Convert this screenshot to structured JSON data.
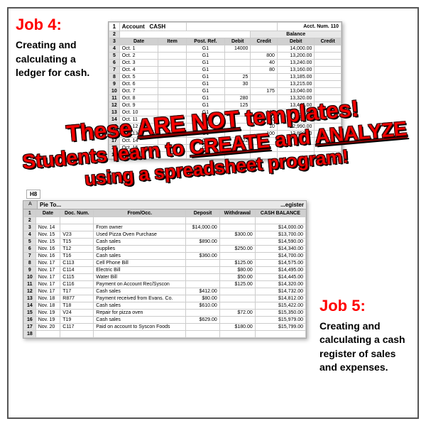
{
  "job4": {
    "title": "Job 4:",
    "description": "Creating and calculating a ledger for cash."
  },
  "job5": {
    "title": "Job 5:",
    "description": "Creating and calculating a cash register of sales and expenses."
  },
  "overlay": {
    "line1": "These ARE NOT templates!",
    "line2": "Students learn to CREATE and ANALYZE",
    "line3": "using a spreadsheet program!"
  },
  "spreadsheet1": {
    "title": "Account  CASH",
    "acct_num": "Acct. Num. 110",
    "col_headers": [
      "Date",
      "Item",
      "Post. Ref.",
      "Debit",
      "Credit",
      "Debit",
      "Credit"
    ],
    "rows": [
      [
        "4",
        "Oct. 1",
        "",
        "G1",
        "14000",
        "",
        "14,000.00",
        ""
      ],
      [
        "5",
        "Oct. 2",
        "",
        "G1",
        "",
        "800",
        "13,200.00",
        ""
      ],
      [
        "6",
        "Oct. 3",
        "",
        "G1",
        "",
        "40",
        "13,240.00",
        ""
      ],
      [
        "7",
        "Oct. 4",
        "",
        "G1",
        "",
        "80",
        "13,160.00",
        ""
      ],
      [
        "8",
        "Oct. 5",
        "",
        "G1",
        "25",
        "",
        "13,185.00",
        ""
      ],
      [
        "9",
        "Oct. 6",
        "",
        "G1",
        "30",
        "",
        "13,215.00",
        ""
      ],
      [
        "10",
        "Oct. 7",
        "",
        "G1",
        "",
        "175",
        "13,040.00",
        ""
      ],
      [
        "11",
        "Oct. 8",
        "",
        "G1",
        "280",
        "",
        "13,320.00",
        ""
      ],
      [
        "12",
        "Oct. 9",
        "",
        "G1",
        "125",
        "",
        "13,445.00",
        ""
      ],
      [
        "13",
        "Oct. 10",
        "",
        "G1",
        "",
        "125",
        "13,320.00",
        ""
      ],
      [
        "14",
        "Oct. 11",
        "",
        "G1",
        "",
        "220",
        "13,100.00",
        ""
      ],
      [
        "15",
        "Oct. 12",
        "",
        "G1",
        "",
        "10",
        "12,990.00",
        ""
      ],
      [
        "16",
        "Oct. 13",
        "",
        "G1",
        "",
        "100",
        "12,890.00",
        ""
      ],
      [
        "17",
        "Oct. 14",
        "",
        "G1",
        "422",
        "",
        "",
        ""
      ],
      [
        "18",
        "Oct. 15",
        "",
        "G1",
        "",
        "",
        "",
        ""
      ],
      [
        "19",
        "",
        "",
        "",
        "",
        "",
        "",
        ""
      ]
    ]
  },
  "spreadsheet2": {
    "title": "Pie To...",
    "subtitle": "...egister",
    "cell_ref": "H8",
    "col_headers": [
      "Date",
      "Doc. Num.",
      "From/Occ.",
      "Deposit",
      "Withdrawal",
      "CASH BALANCE"
    ],
    "rows": [
      [
        "2",
        "",
        "",
        "",
        "",
        ""
      ],
      [
        "3",
        "Nov. 14",
        "",
        "From owner",
        "$14,000.00",
        "",
        "$14,000.00"
      ],
      [
        "4",
        "Nov. 15",
        "V23",
        "Used Pizza Oven Purchase",
        "",
        "$300.00",
        "$13,700.00"
      ],
      [
        "5",
        "Nov. 15",
        "T15",
        "Cash sales",
        "$890.00",
        "",
        "$14,590.00"
      ],
      [
        "6",
        "Nov. 16",
        "T12",
        "Supplies",
        "",
        "$250.00",
        "$14,340.00"
      ],
      [
        "7",
        "Nov. 16",
        "T16",
        "Cash sales",
        "$360.00",
        "",
        "$14,700.00"
      ],
      [
        "8",
        "Nov. 17",
        "C113",
        "Cell Phone Bill",
        "",
        "$125.00",
        "$14,575.00"
      ],
      [
        "9",
        "Nov. 17",
        "C114",
        "Electric Bill",
        "",
        "$80.00",
        "$14,495.00"
      ],
      [
        "10",
        "Nov. 17",
        "C115",
        "Water Bill",
        "",
        "$50.00",
        "$14,445.00"
      ],
      [
        "11",
        "Nov. 17",
        "C116",
        "Payment on Account Rec/Syscon",
        "",
        "$125.00",
        "$14,320.00"
      ],
      [
        "12",
        "Nov. 17",
        "T17",
        "Cash sales",
        "$412.00",
        "",
        "$14,732.00"
      ],
      [
        "13",
        "Nov. 18",
        "R877",
        "Payment received from Evans. Co.",
        "$80.00",
        "",
        "$14,812.00"
      ],
      [
        "14",
        "Nov. 18",
        "T18",
        "Cash sales",
        "$610.00",
        "",
        "$15,422.00"
      ],
      [
        "15",
        "Nov. 19",
        "V24",
        "Repair for pizza oven",
        "",
        "$72.00",
        "$15,350.00"
      ],
      [
        "16",
        "Nov. 19",
        "T19",
        "Cash sales",
        "$629.00",
        "",
        "$15,979.00"
      ],
      [
        "17",
        "Nov. 20",
        "C117",
        "Paid on account to Syscon Foods",
        "",
        "$180.00",
        "$15,799.00"
      ],
      [
        "18",
        "",
        "",
        "",
        "",
        "",
        ""
      ]
    ]
  }
}
